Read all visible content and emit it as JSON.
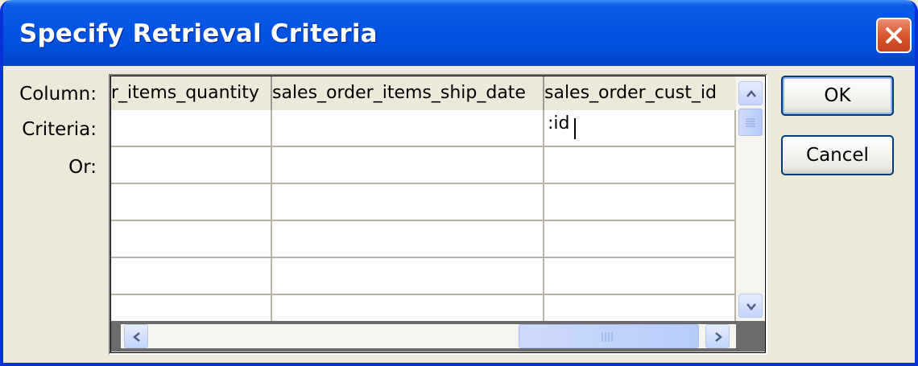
{
  "window": {
    "title": "Specify Retrieval Criteria"
  },
  "labels": {
    "column": "Column:",
    "criteria": "Criteria:",
    "or": "Or:"
  },
  "grid": {
    "columns": [
      "r_items_quantity",
      "sales_order_items_ship_date",
      "sales_order_cust_id"
    ],
    "criteria_values": [
      "",
      "",
      ":id"
    ]
  },
  "buttons": {
    "ok": "OK",
    "cancel": "Cancel"
  },
  "icons": {
    "close": "close-icon",
    "scroll_up": "arrow-up-icon",
    "scroll_down": "arrow-down-icon",
    "scroll_left": "arrow-left-icon",
    "scroll_right": "arrow-right-icon"
  },
  "colors": {
    "titlebar": "#0355e2",
    "close_button": "#d8562d",
    "dialog_bg": "#ece9d8"
  }
}
